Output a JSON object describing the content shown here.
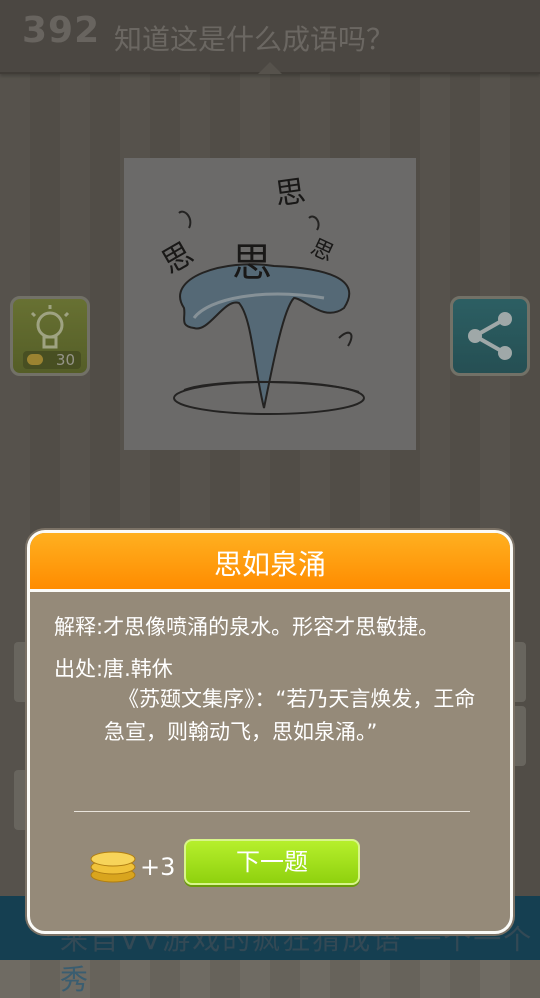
{
  "header": {
    "level": "392",
    "question": "知道这是什么成语吗？"
  },
  "puzzle": {
    "glyph": "思"
  },
  "hint_button": {
    "icon": "lightbulb-icon",
    "cost": "30"
  },
  "share_button": {
    "icon": "share-icon"
  },
  "dialog": {
    "title": "思如泉涌",
    "definition": "解释:才思像喷涌的泉水。形容才思敏捷。",
    "source_label": "出处:唐.韩休",
    "source_text": "《苏颋文集序》：“若乃天言焕发，王命急宣，则翰动飞，思如泉涌。”",
    "reward": "+3",
    "next_label": "下一题"
  },
  "bottom_bar": {
    "text": "来自VV游戏的疯狂猜成语 一个一个秀"
  },
  "colors": {
    "title_bar": "#ff9800",
    "next_button": "#9be01a",
    "dialog_bg": "#958a79"
  }
}
